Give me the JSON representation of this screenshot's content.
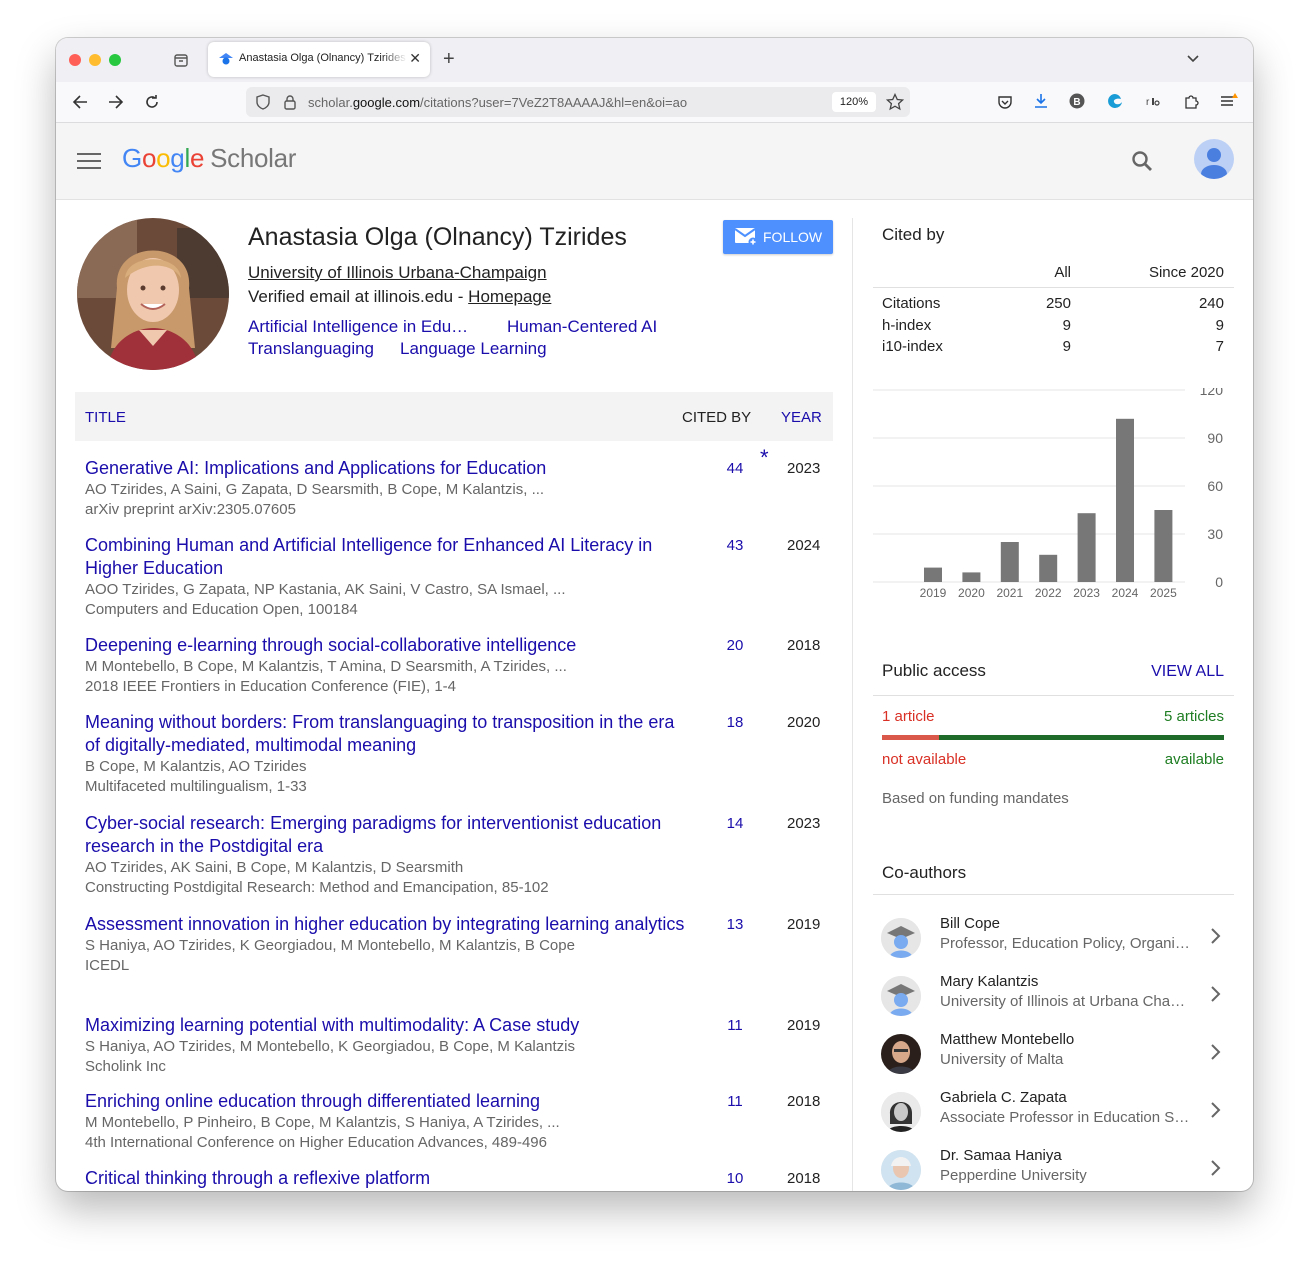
{
  "browser": {
    "tab_title": "Anastasia Olga (Olnancy) Tzirides",
    "url_prefix": "scholar.",
    "url_domain": "google.com",
    "url_path": "/citations?user=7VeZ2T8AAAAJ&hl=en&oi=ao",
    "zoom": "120%"
  },
  "header": {
    "logo_google": "Google",
    "logo_scholar": "Scholar",
    "brand_colors": [
      "#4285f4",
      "#ea4335",
      "#fbbc05",
      "#4285f4",
      "#34a853",
      "#ea4335"
    ]
  },
  "profile": {
    "name": "Anastasia Olga (Olnancy) Tzirides",
    "affiliation": "University of Illinois Urbana-Champaign",
    "email_text": "Verified email at illinois.edu - ",
    "homepage": "Homepage",
    "follow_label": "FOLLOW",
    "interests": [
      "Artificial Intelligence in Edu…",
      "Human-Centered AI",
      "Translanguaging",
      "Language Learning"
    ]
  },
  "table": {
    "head_title": "TITLE",
    "head_cited": "CITED BY",
    "head_year": "YEAR",
    "star": "*",
    "articles": [
      {
        "title": "Generative AI: Implications and Applications for Education",
        "authors": "AO Tzirides, A Saini, G Zapata, D Searsmith, B Cope, M Kalantzis, ...",
        "venue": "arXiv preprint arXiv:2305.07605",
        "cited": "44",
        "year": "2023"
      },
      {
        "title": "Combining Human and Artificial Intelligence for Enhanced AI Literacy in Higher Education",
        "authors": "AOO Tzirides, G Zapata, NP Kastania, AK Saini, V Castro, SA Ismael, ...",
        "venue": "Computers and Education Open, 100184",
        "cited": "43",
        "year": "2024"
      },
      {
        "title": "Deepening e-learning through social-collaborative intelligence",
        "authors": "M Montebello, B Cope, M Kalantzis, T Amina, D Searsmith, A Tzirides, ...",
        "venue": "2018 IEEE Frontiers in Education Conference (FIE), 1-4",
        "cited": "20",
        "year": "2018"
      },
      {
        "title": "Meaning without borders: From translanguaging to transposition in the era of digitally-mediated, multimodal meaning",
        "authors": "B Cope, M Kalantzis, AO Tzirides",
        "venue": "Multifaceted multilingualism, 1-33",
        "cited": "18",
        "year": "2020"
      },
      {
        "title": "Cyber-social research: Emerging paradigms for interventionist education research in the Postdigital era",
        "authors": "AO Tzirides, AK Saini, B Cope, M Kalantzis, D Searsmith",
        "venue": "Constructing Postdigital Research: Method and Emancipation, 85-102",
        "cited": "14",
        "year": "2023"
      },
      {
        "title": "Assessment innovation in higher education by integrating learning analytics",
        "authors": "S Haniya, AO Tzirides, K Georgiadou, M Montebello, M Kalantzis, B Cope",
        "venue": "ICEDL",
        "cited": "13",
        "year": "2019"
      },
      {
        "title": "Maximizing learning potential with multimodality: A Case study",
        "authors": "S Haniya, AO Tzirides, M Montebello, K Georgiadou, B Cope, M Kalantzis",
        "venue": "Scholink Inc",
        "cited": "11",
        "year": "2019"
      },
      {
        "title": "Enriching online education through differentiated learning",
        "authors": "M Montebello, P Pinheiro, B Cope, M Kalantzis, S Haniya, A Tzirides, ...",
        "venue": "4th International Conference on Higher Education Advances, 489-496",
        "cited": "11",
        "year": "2018"
      },
      {
        "title": "Critical thinking through a reflexive platform",
        "authors": "",
        "venue": "",
        "cited": "10",
        "year": "2018"
      }
    ]
  },
  "cited_by": {
    "title": "Cited by",
    "col_all": "All",
    "col_since": "Since 2020",
    "rows": [
      {
        "label": "Citations",
        "all": "250",
        "since": "240"
      },
      {
        "label": "h-index",
        "all": "9",
        "since": "9"
      },
      {
        "label": "i10-index",
        "all": "9",
        "since": "7"
      }
    ]
  },
  "chart_data": {
    "type": "bar",
    "categories": [
      "2019",
      "2020",
      "2021",
      "2022",
      "2023",
      "2024",
      "2025"
    ],
    "values": [
      9,
      6,
      25,
      17,
      43,
      102,
      45
    ],
    "yticks": [
      0,
      30,
      60,
      90,
      120
    ],
    "ylim": [
      0,
      120
    ],
    "grid": true,
    "bar_color": "#777777"
  },
  "public_access": {
    "title": "Public access",
    "view_all": "VIEW ALL",
    "not_available_count": "1 article",
    "available_count": "5 articles",
    "not_available_label": "not available",
    "available_label": "available",
    "not_available_fraction": 0.167,
    "note": "Based on funding mandates"
  },
  "coauthors": {
    "title": "Co-authors",
    "items": [
      {
        "name": "Bill Cope",
        "affiliation": "Professor, Education Policy, Organization and Leadership"
      },
      {
        "name": "Mary Kalantzis",
        "affiliation": "University of Illinois at Urbana Champaign"
      },
      {
        "name": "Matthew Montebello",
        "affiliation": "University of Malta"
      },
      {
        "name": "Gabriela C. Zapata",
        "affiliation": "Associate Professor in Education Studies"
      },
      {
        "name": "Dr. Samaa Haniya",
        "affiliation": "Pepperdine University"
      }
    ]
  }
}
